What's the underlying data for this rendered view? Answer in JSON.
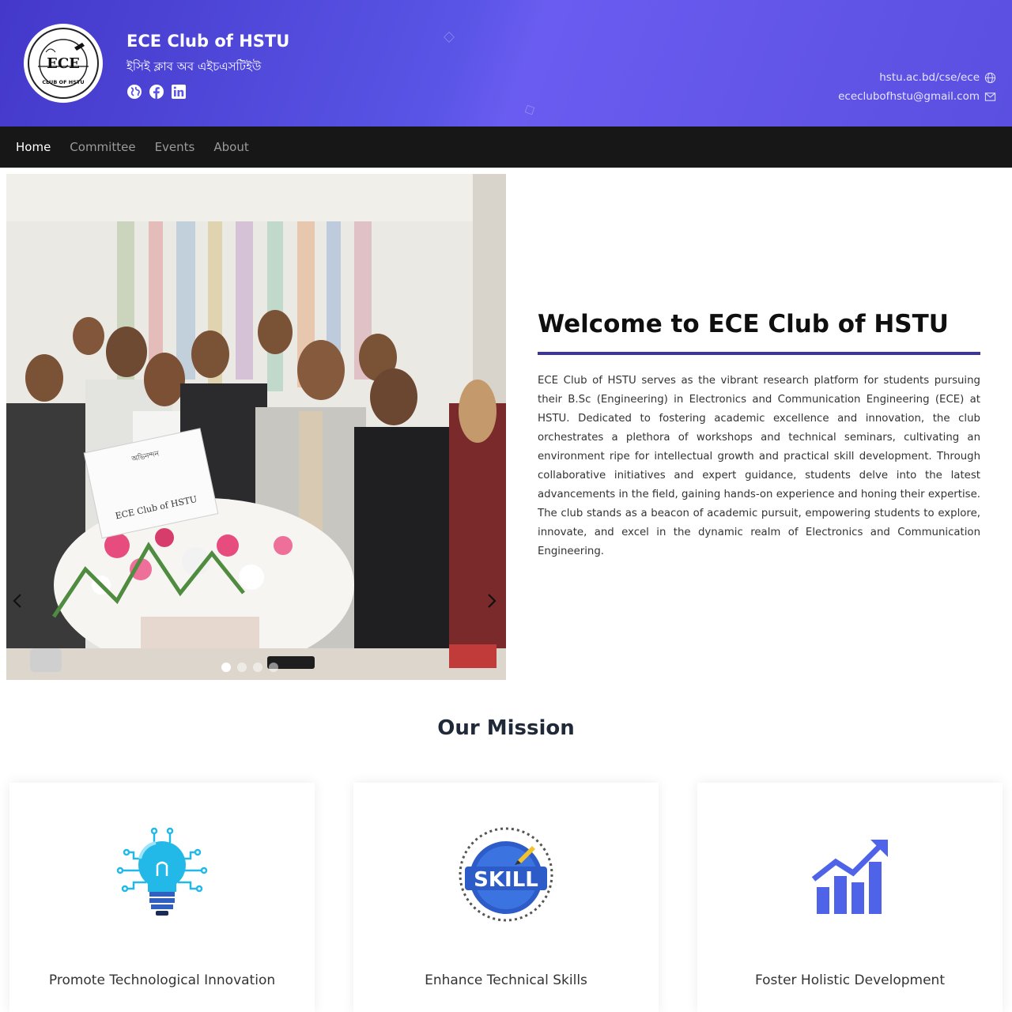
{
  "header": {
    "title": "ECE Club of HSTU",
    "subtitle": "ইসিই ক্লাব অব এইচএসটিইউ",
    "logo_text": "ECE",
    "logo_ring_text": "CLUB OF HSTU",
    "socials": [
      "globe-icon",
      "facebook-icon",
      "linkedin-icon"
    ],
    "website": "hstu.ac.bd/cse/ece",
    "email": "ececlubofhstu@gmail.com"
  },
  "nav": {
    "items": [
      "Home",
      "Committee",
      "Events",
      "About"
    ],
    "active": "Home"
  },
  "carousel": {
    "slide_count": 4,
    "active_slide": 1,
    "caption_sign": "ECE Club of HSTU",
    "caption_sign_top": "অভিনন্দন"
  },
  "welcome": {
    "title": "Welcome to ECE Club of HSTU",
    "body": "ECE Club of HSTU serves as the vibrant research platform for students pursuing their B.Sc (Engineering) in Electronics and Communication Engineering (ECE) at HSTU. Dedicated to fostering academic excellence and innovation, the club orchestrates a plethora of workshops and technical seminars, cultivating an environment ripe for intellectual growth and practical skill development. Through collaborative initiatives and expert guidance, students delve into the latest advancements in the field, gaining hands-on experience and honing their expertise. The club stands as a beacon of academic pursuit, empowering students to explore, innovate, and excel in the dynamic realm of Electronics and Communication Engineering."
  },
  "mission": {
    "title": "Our Mission",
    "cards": [
      {
        "title": "Promote Technological Innovation",
        "icon": "lightbulb-circuit-icon"
      },
      {
        "title": "Enhance Technical Skills",
        "icon": "skill-badge-icon",
        "badge_text": "SKILL"
      },
      {
        "title": "Foster Holistic Development",
        "icon": "growth-chart-icon"
      }
    ]
  },
  "colors": {
    "header_gradient_start": "#4338ca",
    "header_gradient_end": "#6a5cf0",
    "nav_bg": "#171717",
    "accent_rule": "#3b35a0",
    "chart_blue": "#4f63e8",
    "bulb_cyan": "#22b8e8"
  }
}
